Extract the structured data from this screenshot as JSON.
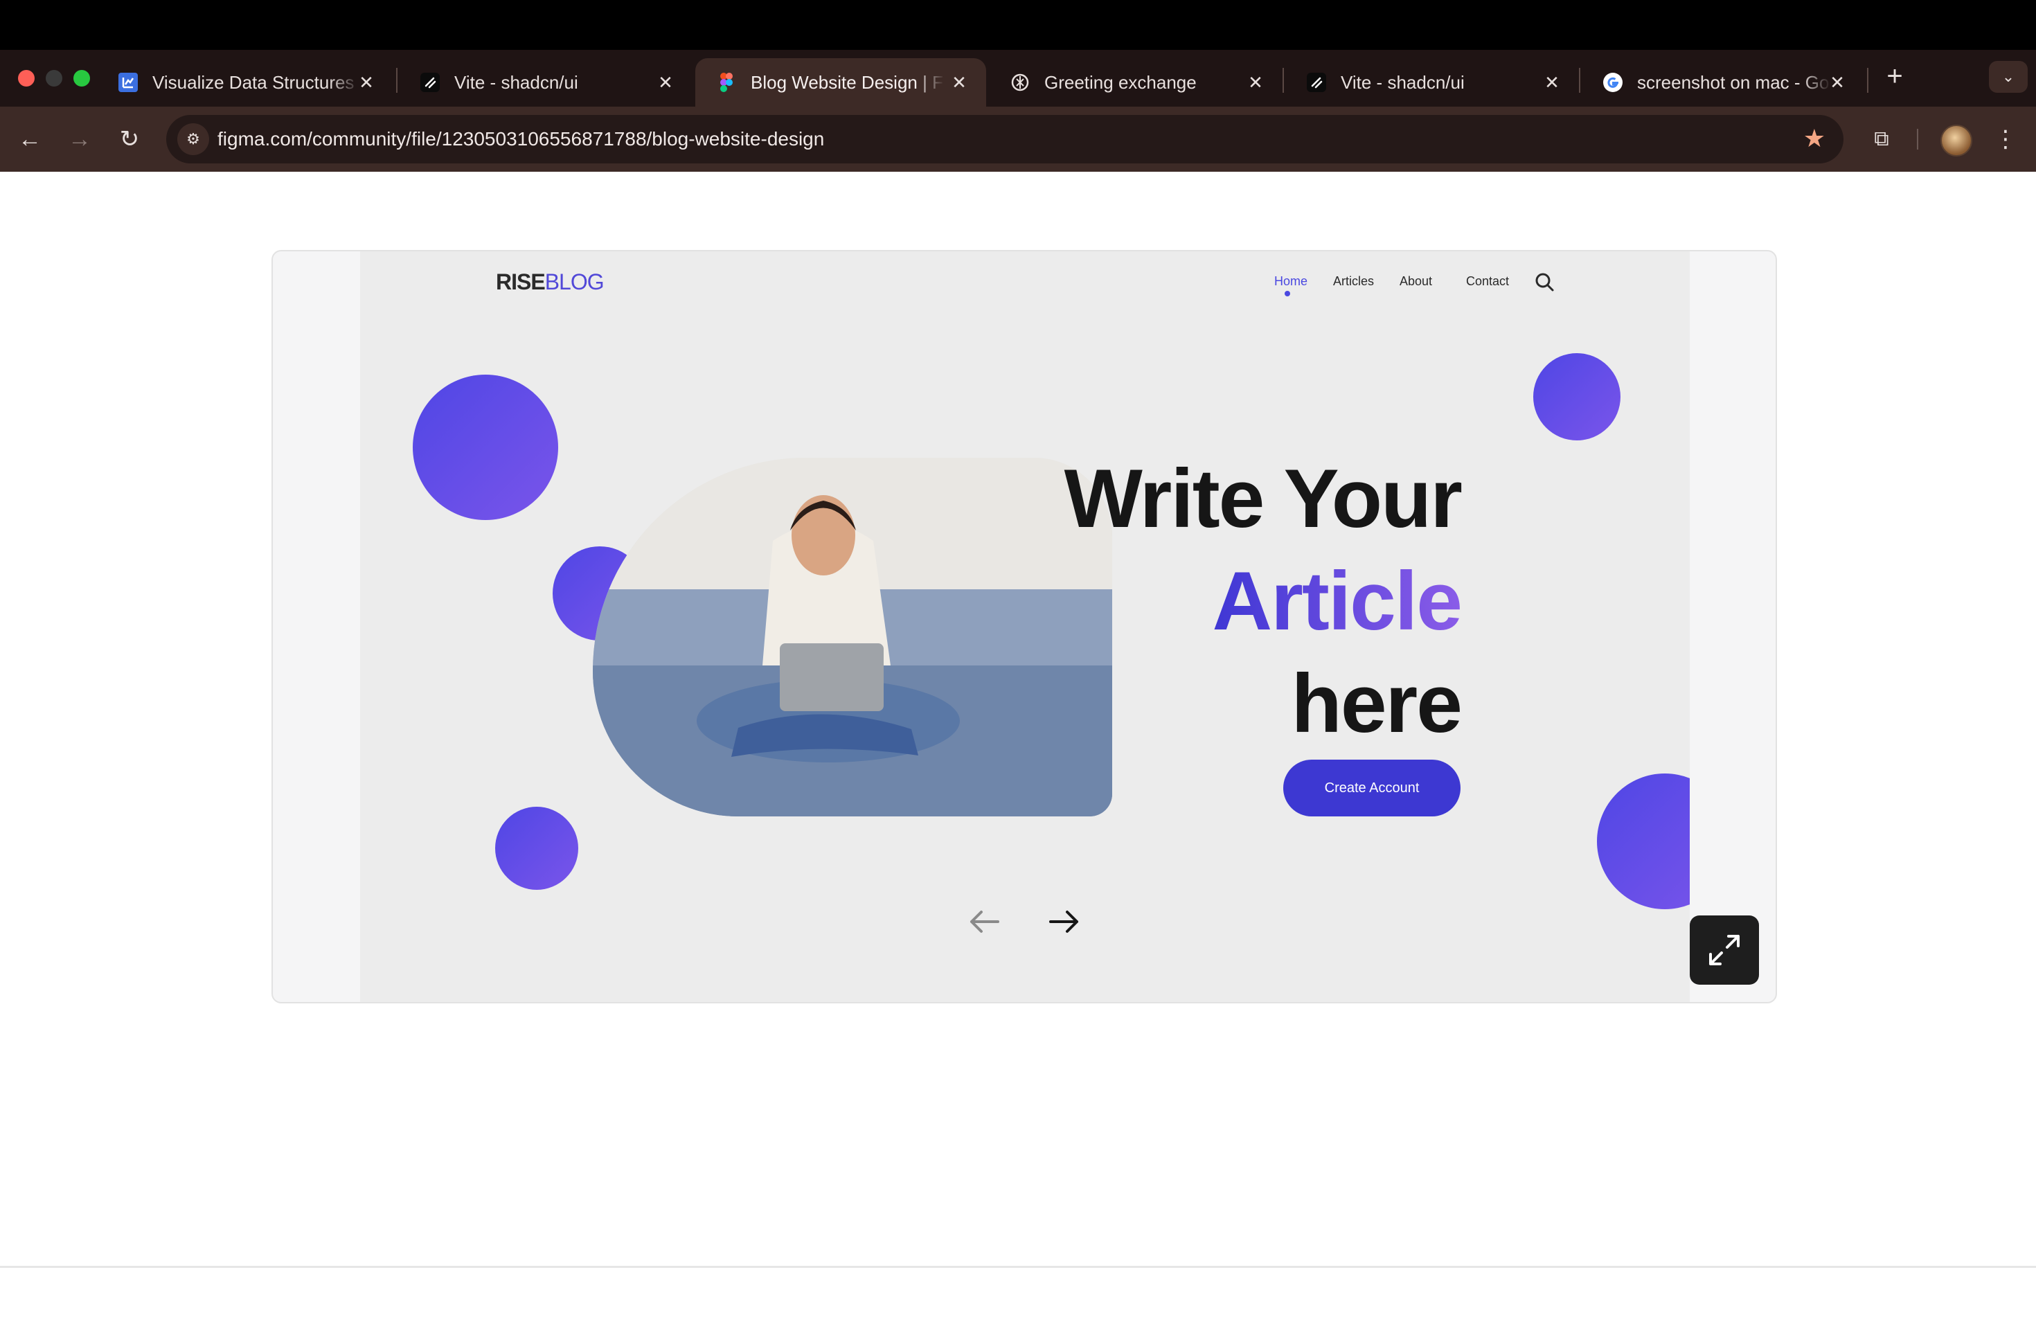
{
  "browser": {
    "tabs": [
      {
        "title": "Visualize Data Structures",
        "icon": "visualizer-favicon"
      },
      {
        "title": "Vite - shadcn/ui",
        "icon": "shadcn-favicon"
      },
      {
        "title": "Blog Website Design | Figma",
        "icon": "figma-favicon",
        "active": true
      },
      {
        "title": "Greeting exchange",
        "icon": "chatgpt-favicon"
      },
      {
        "title": "Vite - shadcn/ui",
        "icon": "shadcn-favicon"
      },
      {
        "title": "screenshot on mac - Google Search",
        "icon": "google-favicon"
      }
    ],
    "url": "figma.com/community/file/1230503106556871788/blog-website-design",
    "colors": {
      "chrome_bg": "#3d2a26",
      "tabstrip_bg": "#1f1414",
      "star": "#f5a684"
    }
  },
  "preview": {
    "logo": {
      "part1": "RISE",
      "part2": "BLOG"
    },
    "nav": [
      "Home",
      "Articles",
      "About",
      "Contact"
    ],
    "active_nav": "Home",
    "headline": {
      "line1": "Write Your",
      "line2": "Article",
      "line3": "here"
    },
    "cta_label": "Create Account",
    "colors": {
      "accent": "#4f46e5",
      "accent_end": "#7a55ea",
      "canvas_bg": "#ececec"
    }
  }
}
